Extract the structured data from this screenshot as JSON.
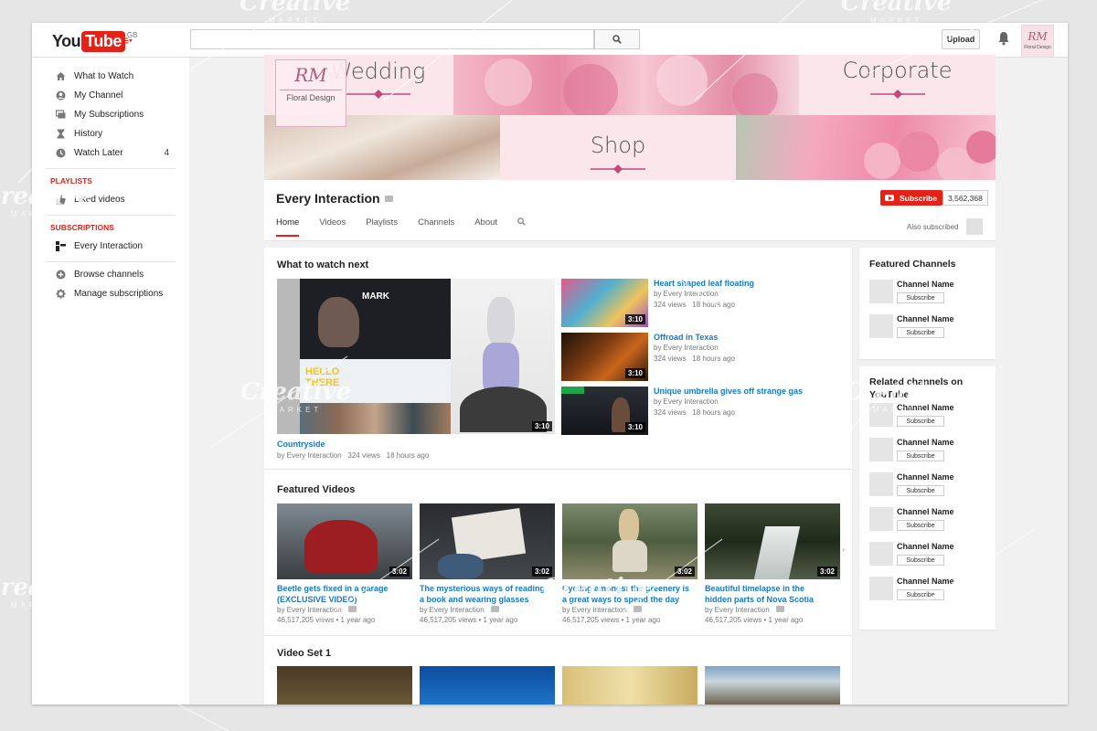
{
  "header": {
    "logo_you": "You",
    "logo_tube": "Tube",
    "logo_region": "GB",
    "search_placeholder": "",
    "upload_label": "Upload",
    "avatar_text": "RM",
    "avatar_sub": "Floral Design"
  },
  "sidebar": {
    "items": [
      {
        "label": "What to Watch",
        "icon": "home-icon"
      },
      {
        "label": "My Channel",
        "icon": "user-icon"
      },
      {
        "label": "My Subscriptions",
        "icon": "subscriptions-icon"
      },
      {
        "label": "History",
        "icon": "hourglass-icon"
      },
      {
        "label": "Watch Later",
        "icon": "clock-icon",
        "count": "4"
      }
    ],
    "playlists_heading": "PLAYLISTS",
    "liked_label": "Liked videos",
    "subscriptions_heading": "SUBSCRIPTIONS",
    "subscription_label": "Every Interaction",
    "browse_label": "Browse channels",
    "manage_label": "Manage subscriptions"
  },
  "banner": {
    "wedding": "Wedding",
    "corporate": "Corporate",
    "shop": "Shop",
    "logo_text": "RM",
    "logo_sub": "Floral Design"
  },
  "channel": {
    "name": "Every Interaction",
    "subscribe_label": "Subscribe",
    "subscriber_count": "3,562,368",
    "tabs": [
      "Home",
      "Videos",
      "Playlists",
      "Channels",
      "About"
    ],
    "also_subscribed": "Also subscribed"
  },
  "what_to_watch": {
    "heading": "What to watch next",
    "main": {
      "title": "Countryside",
      "by": "by Every Interaction",
      "views": "324 views",
      "age": "18 hours ago",
      "duration": "3:10",
      "overlay_mark": "MARK",
      "overlay_hello": "HELLO",
      "overlay_there": "THERE"
    },
    "side": [
      {
        "title": "Heart shaped leaf floating",
        "by": "by Every Interaction",
        "views": "324 views",
        "age": "18 hours ago",
        "duration": "3:10"
      },
      {
        "title": "Offroad in Texas",
        "by": "by Every Interaction",
        "views": "324 views",
        "age": "18 hours ago",
        "duration": "3:10"
      },
      {
        "title": "Unique umbrella gives off strange gas",
        "by": "by Every Interaction",
        "views": "324 views",
        "age": "18 hours ago",
        "duration": "3:10"
      }
    ]
  },
  "featured_videos": {
    "heading": "Featured Videos",
    "items": [
      {
        "title1": "Beetle gets fixed in a garage",
        "title2": "(EXCLUSIVE VIDEO)",
        "by": "by Every Interaction",
        "views": "46,517,205 views",
        "age": "1 year ago",
        "duration": "3:02"
      },
      {
        "title1": "The mysterious ways of reading",
        "title2": "a book and wearing glasses",
        "by": "by Every Interaction",
        "views": "46,517,205 views",
        "age": "1 year ago",
        "duration": "3:02"
      },
      {
        "title1": "Cycling amongst the greenery is",
        "title2": "a great ways to spend the day",
        "by": "by Every Interaction",
        "views": "46,517,205 views",
        "age": "1 year ago",
        "duration": "3:02"
      },
      {
        "title1": "Beautiful timelapse in the",
        "title2": "hidden parts of Nova Scotia",
        "by": "by Every Interaction",
        "views": "46,517,205 views",
        "age": "1 year ago",
        "duration": "3:02"
      }
    ]
  },
  "video_set": {
    "heading": "Video Set 1"
  },
  "featured_channels": {
    "heading": "Featured Channels",
    "items": [
      {
        "name": "Channel Name",
        "button": "Subscribe"
      },
      {
        "name": "Channel Name",
        "button": "Subscribe"
      }
    ]
  },
  "related_channels": {
    "heading1": "Related channels on",
    "heading2": "YouTube",
    "items": [
      {
        "name": "Channel Name",
        "button": "Subscribe"
      },
      {
        "name": "Channel Name",
        "button": "Subscribe"
      },
      {
        "name": "Channel Name",
        "button": "Subscribe"
      },
      {
        "name": "Channel Name",
        "button": "Subscribe"
      },
      {
        "name": "Channel Name",
        "button": "Subscribe"
      },
      {
        "name": "Channel Name",
        "button": "Subscribe"
      }
    ]
  },
  "watermark": {
    "main": "Creative",
    "sub": "MARKET"
  },
  "colors": {
    "brand_red": "#e62117",
    "link_blue": "#167ac6",
    "banner_pink": "#fbe3ea"
  }
}
